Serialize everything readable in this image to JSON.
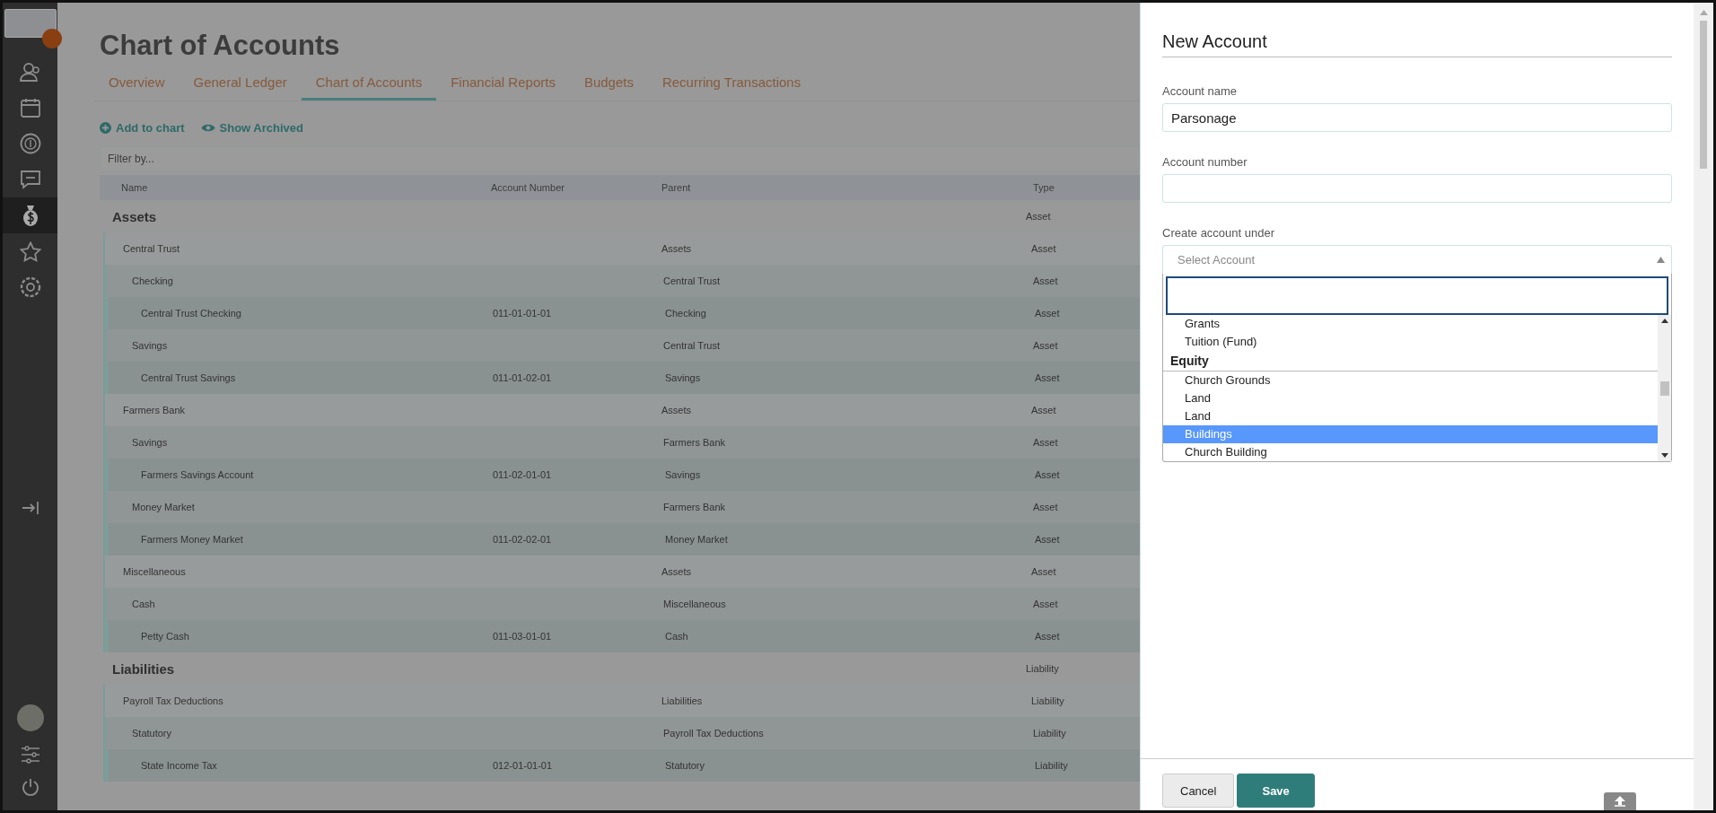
{
  "sidebar": {
    "items": [
      {
        "kind": "people",
        "selected": false
      },
      {
        "kind": "calendar",
        "selected": false
      },
      {
        "kind": "coin",
        "selected": false
      },
      {
        "kind": "chat",
        "selected": false
      },
      {
        "kind": "money-bag",
        "selected": true
      },
      {
        "kind": "star",
        "selected": false
      },
      {
        "kind": "gear",
        "selected": false
      }
    ]
  },
  "page": {
    "title": "Chart of Accounts",
    "tabs": [
      {
        "label": "Overview",
        "selected": false
      },
      {
        "label": "General Ledger",
        "selected": false
      },
      {
        "label": "Chart of Accounts",
        "selected": true
      },
      {
        "label": "Financial Reports",
        "selected": false
      },
      {
        "label": "Budgets",
        "selected": false
      },
      {
        "label": "Recurring Transactions",
        "selected": false
      }
    ],
    "actions": [
      {
        "kind": "add",
        "label": "Add to chart"
      },
      {
        "kind": "archive",
        "label": "Show Archived"
      }
    ],
    "filter": {
      "placeholder": "Filter by..."
    },
    "table": {
      "columns": [
        "Name",
        "Account Number",
        "Parent",
        "Type"
      ],
      "sections": [
        {
          "name": "Assets",
          "type": "Asset",
          "children": [
            {
              "name": "Central Trust",
              "parent": "Assets",
              "type": "Asset",
              "children": [
                {
                  "name": "Checking",
                  "parent": "Central Trust",
                  "type": "Asset",
                  "children": [
                    {
                      "name": "Central Trust Checking",
                      "number": "011-01-01-01",
                      "parent": "Checking",
                      "type": "Asset"
                    }
                  ]
                },
                {
                  "name": "Savings",
                  "parent": "Central Trust",
                  "type": "Asset",
                  "children": [
                    {
                      "name": "Central Trust Savings",
                      "number": "011-01-02-01",
                      "parent": "Savings",
                      "type": "Asset"
                    }
                  ]
                }
              ]
            },
            {
              "name": "Farmers Bank",
              "parent": "Assets",
              "type": "Asset",
              "children": [
                {
                  "name": "Savings",
                  "parent": "Farmers Bank",
                  "type": "Asset",
                  "children": [
                    {
                      "name": "Farmers Savings Account",
                      "number": "011-02-01-01",
                      "parent": "Savings",
                      "type": "Asset"
                    }
                  ]
                },
                {
                  "name": "Money Market",
                  "parent": "Farmers Bank",
                  "type": "Asset",
                  "children": [
                    {
                      "name": "Farmers Money Market",
                      "number": "011-02-02-01",
                      "parent": "Money Market",
                      "type": "Asset"
                    }
                  ]
                }
              ]
            },
            {
              "name": "Miscellaneous",
              "parent": "Assets",
              "type": "Asset",
              "children": [
                {
                  "name": "Cash",
                  "parent": "Miscellaneous",
                  "type": "Asset",
                  "children": [
                    {
                      "name": "Petty Cash",
                      "number": "011-03-01-01",
                      "parent": "Cash",
                      "type": "Asset"
                    }
                  ]
                }
              ]
            }
          ]
        },
        {
          "name": "Liabilities",
          "type": "Liability",
          "children": [
            {
              "name": "Payroll Tax Deductions",
              "parent": "Liabilities",
              "type": "Liability",
              "children": [
                {
                  "name": "Statutory",
                  "parent": "Payroll Tax Deductions",
                  "type": "Liability",
                  "children": [
                    {
                      "name": "State Income Tax",
                      "number": "012-01-01-01",
                      "parent": "Statutory",
                      "type": "Liability"
                    }
                  ]
                }
              ]
            }
          ]
        }
      ]
    }
  },
  "panel": {
    "title": "New Account",
    "fields": [
      {
        "label": "Account name",
        "value": "Parsonage"
      },
      {
        "label": "Account number"
      }
    ],
    "select": {
      "label": "Create account under",
      "placeholder": "Select Account",
      "options": [
        {
          "kind": "option",
          "label": "Grants",
          "selected": false
        },
        {
          "kind": "option",
          "label": "Tuition (Fund)",
          "selected": false
        },
        {
          "kind": "group",
          "label": "Equity"
        },
        {
          "kind": "option",
          "label": "Church Grounds",
          "selected": false
        },
        {
          "kind": "option",
          "label": "Land",
          "selected": false
        },
        {
          "kind": "option",
          "label": "Land",
          "selected": false
        },
        {
          "kind": "option",
          "label": "Buildings",
          "selected": true
        },
        {
          "kind": "option",
          "label": "Church Building",
          "selected": false
        }
      ]
    },
    "buttons": [
      {
        "kind": "secondary",
        "label": "Cancel"
      },
      {
        "kind": "primary",
        "label": "Save"
      }
    ]
  }
}
